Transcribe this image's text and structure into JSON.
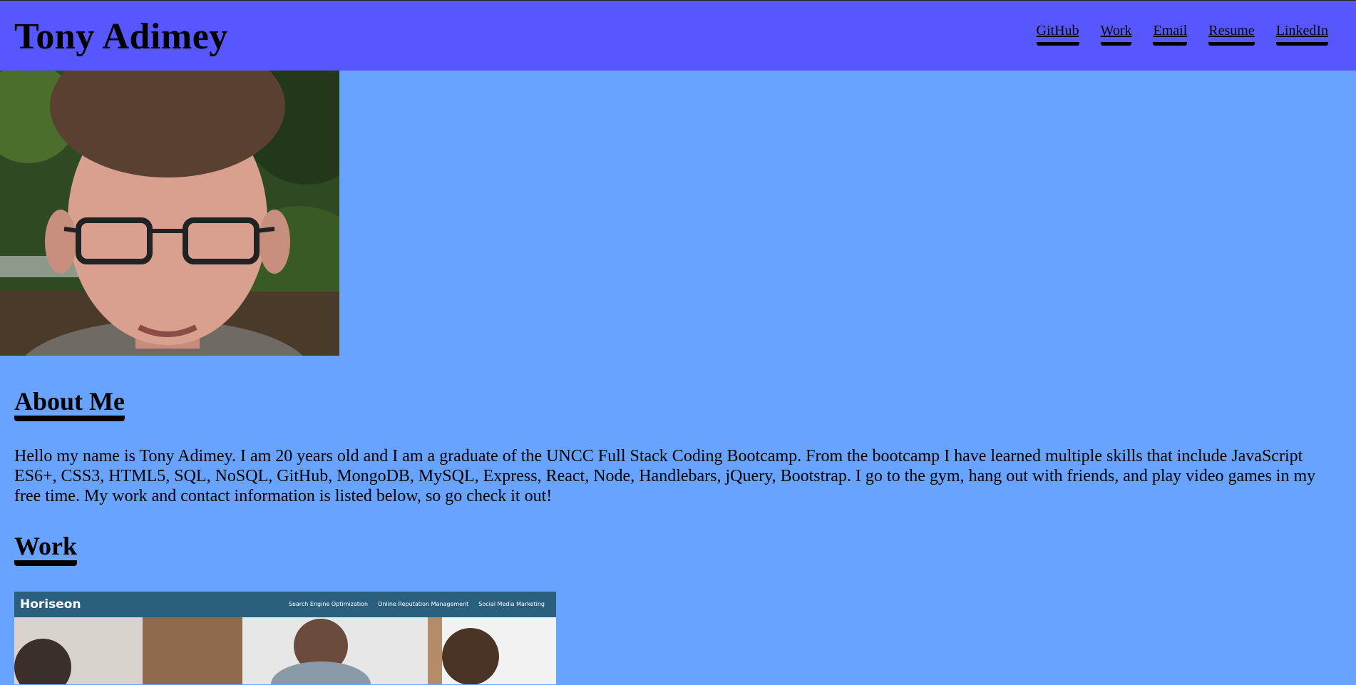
{
  "site": {
    "title": "Tony Adimey",
    "nav": [
      "GitHub",
      "Work",
      "Email",
      "Resume",
      "LinkedIn"
    ]
  },
  "about": {
    "heading": "About Me",
    "text": "Hello my name is Tony Adimey. I am 20 years old and I am a graduate of the UNCC Full Stack Coding Bootcamp. From the bootcamp I have learned multiple skills that include JavaScript ES6+, CSS3, HTML5, SQL, NoSQL, GitHub, MongoDB, MySQL, Express, React, Node, Handlebars, jQuery, Bootstrap. I go to the gym, hang out with friends, and play video games in my free time. My work and contact information is listed below, so go check it out!"
  },
  "work": {
    "heading": "Work",
    "preview": {
      "brand": "Horiseon",
      "links": [
        "Search Engine Optimization",
        "Online Reputation Management",
        "Social Media Marketing"
      ]
    }
  },
  "colors": {
    "header_bg": "#5757ff",
    "page_bg": "#67a3ff",
    "preview_bar": "#2a607e"
  }
}
